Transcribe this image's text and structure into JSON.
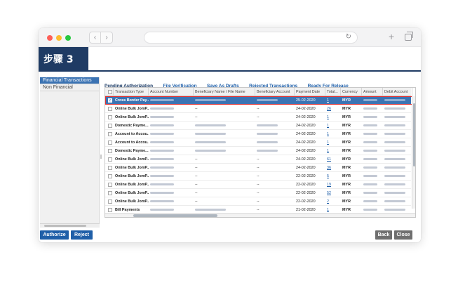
{
  "step": {
    "label": "步骤 3"
  },
  "sidebar": {
    "items": [
      {
        "label": "Financial Transactions",
        "active": true
      },
      {
        "label": "Non Financial",
        "active": false
      }
    ]
  },
  "tabs": [
    {
      "label": "Pending Authorization",
      "active": true
    },
    {
      "label": "File Verification",
      "active": false
    },
    {
      "label": "Save As Drafts",
      "active": false
    },
    {
      "label": "Rejected Transactions",
      "active": false
    },
    {
      "label": "Ready For Release",
      "active": false
    }
  ],
  "table": {
    "columns": [
      "Transaction Type",
      "Account Number",
      "Beneficiary Name / File Name",
      "Beneficiary Account",
      "Payment Date",
      "Total...",
      "Currency",
      "Amount",
      "Debit Account"
    ],
    "rows": [
      {
        "type": "Cross Border Pay...",
        "beneficiary_name": "",
        "beneficiary_account": "",
        "date": "25-02-2020",
        "total": "1",
        "currency": "MYR",
        "selected": true
      },
      {
        "type": "Online Bulk JomP...",
        "beneficiary_name": "--",
        "beneficiary_account": "--",
        "date": "24-02-2020",
        "total": "26",
        "currency": "MYR",
        "selected": false
      },
      {
        "type": "Online Bulk JomP...",
        "beneficiary_name": "--",
        "beneficiary_account": "--",
        "date": "24-02-2020",
        "total": "1",
        "currency": "MYR",
        "selected": false
      },
      {
        "type": "Domestic Payme...",
        "beneficiary_name": "",
        "beneficiary_account": "",
        "date": "24-02-2020",
        "total": "1",
        "currency": "MYR",
        "selected": false
      },
      {
        "type": "Account to Accou...",
        "beneficiary_name": "",
        "beneficiary_account": "",
        "date": "24-02-2020",
        "total": "1",
        "currency": "MYR",
        "selected": false
      },
      {
        "type": "Account to Accou...",
        "beneficiary_name": "",
        "beneficiary_account": "",
        "date": "24-02-2020",
        "total": "1",
        "currency": "MYR",
        "selected": false
      },
      {
        "type": "Domestic Payme...",
        "beneficiary_name": "",
        "beneficiary_account": "",
        "date": "24-02-2020",
        "total": "1",
        "currency": "MYR",
        "selected": false
      },
      {
        "type": "Online Bulk JomP...",
        "beneficiary_name": "--",
        "beneficiary_account": "--",
        "date": "24-02-2020",
        "total": "61",
        "currency": "MYR",
        "selected": false
      },
      {
        "type": "Online Bulk JomP...",
        "beneficiary_name": "--",
        "beneficiary_account": "--",
        "date": "24-02-2020",
        "total": "36",
        "currency": "MYR",
        "selected": false
      },
      {
        "type": "Online Bulk JomP...",
        "beneficiary_name": "--",
        "beneficiary_account": "--",
        "date": "22-02-2020",
        "total": "5",
        "currency": "MYR",
        "selected": false
      },
      {
        "type": "Online Bulk JomP...",
        "beneficiary_name": "--",
        "beneficiary_account": "--",
        "date": "22-02-2020",
        "total": "19",
        "currency": "MYR",
        "selected": false
      },
      {
        "type": "Online Bulk JomP...",
        "beneficiary_name": "--",
        "beneficiary_account": "--",
        "date": "22-02-2020",
        "total": "52",
        "currency": "MYR",
        "selected": false
      },
      {
        "type": "Online Bulk JomP...",
        "beneficiary_name": "--",
        "beneficiary_account": "--",
        "date": "22-02-2020",
        "total": "2",
        "currency": "MYR",
        "selected": false
      },
      {
        "type": "Bill Payments",
        "beneficiary_name": "",
        "beneficiary_account": "--",
        "date": "21-02-2020",
        "total": "1",
        "currency": "MYR",
        "selected": false
      }
    ]
  },
  "actions": {
    "authorize": "Authorize",
    "reject": "Reject",
    "back": "Back",
    "close": "Close"
  }
}
